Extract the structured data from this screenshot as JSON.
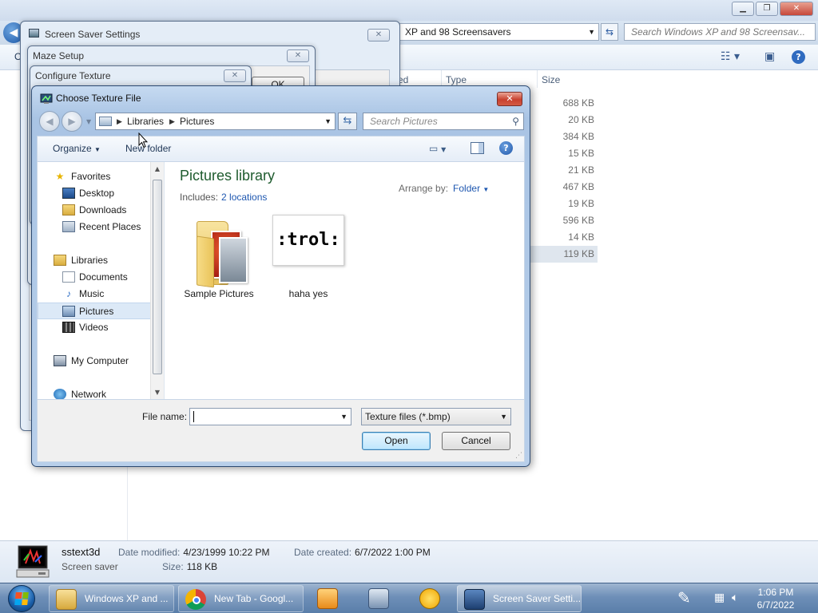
{
  "explorer": {
    "address_text": "XP and 98 Screensavers",
    "search_placeholder": "Search Windows XP and 98 Screensav...",
    "columns": {
      "type": "Type",
      "size": "Size",
      "partial": "ed"
    },
    "file_sizes": [
      "688 KB",
      "20 KB",
      "384 KB",
      "15 KB",
      "21 KB",
      "467 KB",
      "19 KB",
      "596 KB",
      "14 KB",
      "119 KB"
    ],
    "selected_size_index": 9,
    "left_partial": "O"
  },
  "details_pane": {
    "name": "sstext3d",
    "type": "Screen saver",
    "date_modified_label": "Date modified:",
    "date_modified": "4/23/1999 10:22 PM",
    "date_created_label": "Date created:",
    "date_created": "6/7/2022 1:00 PM",
    "size_label": "Size:",
    "size": "118 KB"
  },
  "dialogs": {
    "screen_saver_settings": {
      "title": "Screen Saver Settings"
    },
    "maze_setup": {
      "title": "Maze Setup",
      "ok_partial": "OK"
    },
    "configure_texture": {
      "title": "Configure Texture"
    }
  },
  "choose_texture": {
    "title": "Choose Texture File",
    "breadcrumb": [
      "Libraries",
      "Pictures"
    ],
    "search_placeholder": "Search Pictures",
    "toolbar": {
      "organize": "Organize",
      "new_folder": "New folder"
    },
    "nav": {
      "favorites": "Favorites",
      "desktop": "Desktop",
      "downloads": "Downloads",
      "recent_places": "Recent Places",
      "libraries": "Libraries",
      "documents": "Documents",
      "music": "Music",
      "pictures": "Pictures",
      "videos": "Videos",
      "my_computer": "My Computer",
      "network": "Network"
    },
    "library_title": "Pictures library",
    "includes_label": "Includes:",
    "includes_link": "2 locations",
    "arrange_label": "Arrange by:",
    "arrange_value": "Folder",
    "items": [
      {
        "name": "Sample Pictures",
        "kind": "folder"
      },
      {
        "name": "haha yes",
        "kind": "image",
        "thumb_text": ":trol:"
      }
    ],
    "file_name_label": "File name:",
    "file_name_value": "",
    "file_type": "Texture files (*.bmp)",
    "open_label": "Open",
    "cancel_label": "Cancel"
  },
  "taskbar": {
    "tasks": [
      {
        "label": "Windows XP and ...",
        "icon": "folder-icon"
      },
      {
        "label": "New Tab - Googl...",
        "icon": "chrome-icon"
      },
      {
        "label": "Screen Saver Setti...",
        "icon": "screensaver-icon",
        "active": true
      }
    ],
    "clock_time": "1:06 PM",
    "clock_date": "6/7/2022"
  },
  "colors": {
    "library_title": "#1e5b2e",
    "link": "#1e57b0",
    "close_red": "#c8412f",
    "taskbar": "#6e8fb8"
  }
}
